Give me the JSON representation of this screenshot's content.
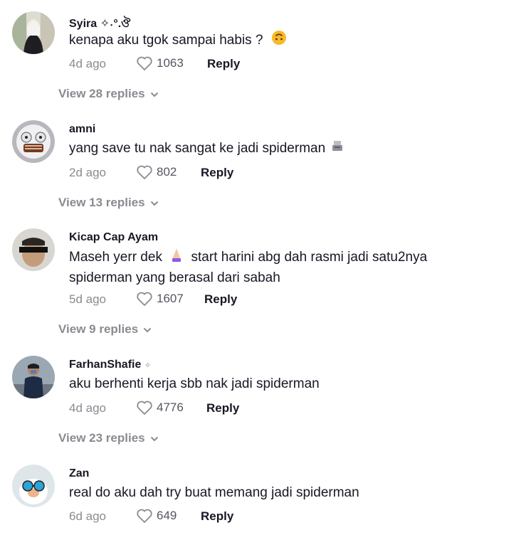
{
  "comments": [
    {
      "username": "Syira ✧˖°.ঔ",
      "text": "kenapa aku tgok sampai habis ?",
      "emoji": "upside-down-face-emoji",
      "date": "4d ago",
      "likes": "1063",
      "reply_label": "Reply",
      "view_replies": "View 28 replies"
    },
    {
      "username": "amni",
      "text": "yang save tu nak sangat ke jadi spiderman",
      "emoji": "cash-register-emoji",
      "date": "2d ago",
      "likes": "802",
      "reply_label": "Reply",
      "view_replies": "View 13 replies"
    },
    {
      "username": "Kicap Cap Ayam",
      "text_part1": "Maseh yerr dek",
      "text_part2": "start harini abg dah rasmi jadi satu2nya",
      "text_line2": "spiderman yang berasal dari sabah",
      "emoji": "praying-hands-emoji",
      "date": "5d ago",
      "likes": "1607",
      "reply_label": "Reply",
      "view_replies": "View 9 replies"
    },
    {
      "username": "FarhanShafie",
      "text": "aku berhenti kerja sbb nak jadi spiderman",
      "date": "4d ago",
      "likes": "4776",
      "reply_label": "Reply",
      "view_replies": "View 23 replies"
    },
    {
      "username": "Zan",
      "text": "real do aku dah try buat memang jadi spiderman",
      "date": "6d ago",
      "likes": "649",
      "reply_label": "Reply"
    }
  ],
  "icons": {
    "like": "heart-outline-icon",
    "expand": "chevron-down-icon"
  },
  "colors": {
    "primary_text": "#161823",
    "secondary_text": "#8a8b91",
    "like_count": "#545661",
    "background": "#ffffff"
  }
}
